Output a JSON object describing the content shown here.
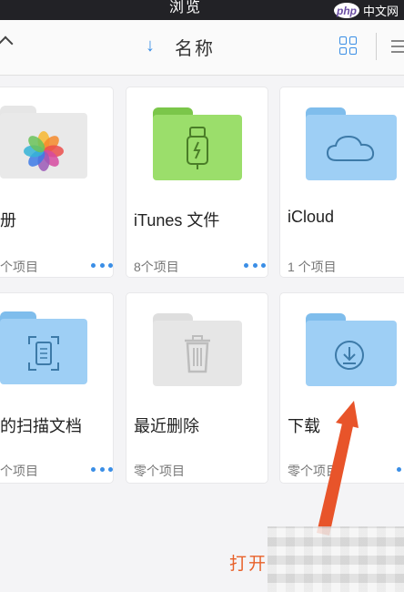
{
  "status": {
    "title": "浏览"
  },
  "watermark": {
    "logo": "php",
    "text": "中文网"
  },
  "toolbar": {
    "sort_arrow": "↓",
    "sort_label": "名称"
  },
  "items": [
    {
      "name": "册",
      "count": "个项目",
      "icon": "photos-folder-icon"
    },
    {
      "name": "iTunes 文件",
      "count": "8个项目",
      "icon": "itunes-folder-icon"
    },
    {
      "name": "iCloud",
      "count": "1 个项目",
      "icon": "icloud-folder-icon"
    },
    {
      "name": "的扫描文档",
      "count": "个项目",
      "icon": "scan-folder-icon"
    },
    {
      "name": "最近删除",
      "count": "零个项目",
      "icon": "trash-folder-icon"
    },
    {
      "name": "下载",
      "count": "零个项目",
      "icon": "download-folder-icon"
    }
  ],
  "bottom": {
    "open_label": "打开"
  }
}
